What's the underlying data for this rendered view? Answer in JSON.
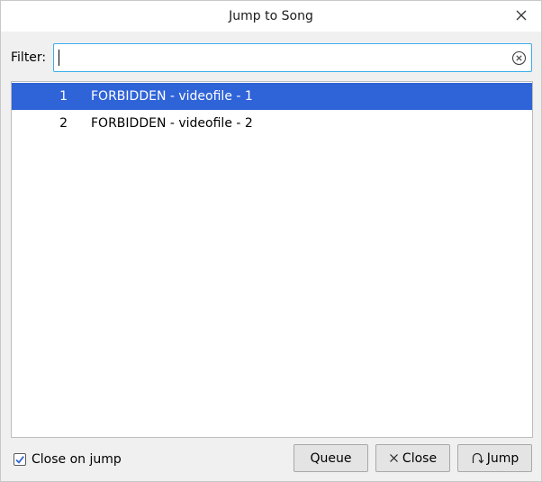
{
  "window": {
    "title": "Jump to Song"
  },
  "filter": {
    "label": "Filter:",
    "value": "",
    "placeholder": ""
  },
  "songs": [
    {
      "number": "1",
      "title": "FORBIDDEN - videofile - 1",
      "selected": true
    },
    {
      "number": "2",
      "title": "FORBIDDEN - videofile - 2",
      "selected": false
    }
  ],
  "options": {
    "close_on_jump_label": "Close on jump",
    "close_on_jump_checked": true
  },
  "buttons": {
    "queue_label": "Queue",
    "close_label": "Close",
    "jump_label": "Jump"
  },
  "colors": {
    "selection": "#2f63d8",
    "focus_border": "#3daee9",
    "checkbox_check": "#2f63d8"
  },
  "icons": {
    "window_close": "close-icon",
    "filter_clear": "clear-circle-icon",
    "close_button": "x-icon",
    "jump_button": "jump-arrow-icon",
    "checkbox": "checkmark-icon"
  }
}
